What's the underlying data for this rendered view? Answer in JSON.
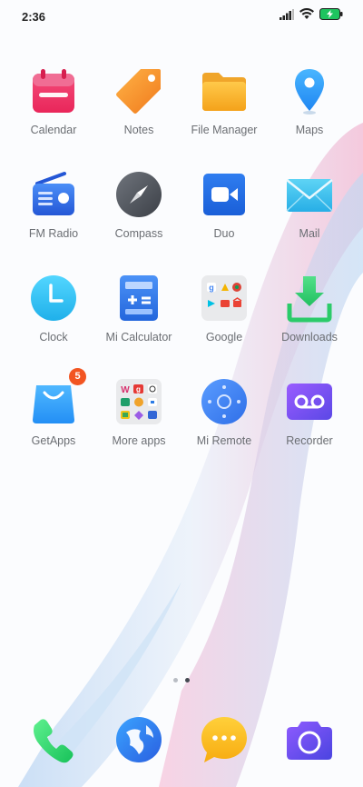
{
  "status_bar": {
    "time": "2:36",
    "icons": [
      "signal-icon",
      "wifi-icon",
      "battery-charging-icon"
    ]
  },
  "apps": [
    {
      "label": "Calendar",
      "icon": "calendar-icon"
    },
    {
      "label": "Notes",
      "icon": "notes-icon"
    },
    {
      "label": "File Manager",
      "icon": "folder-icon"
    },
    {
      "label": "Maps",
      "icon": "map-pin-icon"
    },
    {
      "label": "FM Radio",
      "icon": "radio-icon"
    },
    {
      "label": "Compass",
      "icon": "compass-icon"
    },
    {
      "label": "Duo",
      "icon": "video-camera-icon"
    },
    {
      "label": "Mail",
      "icon": "envelope-icon"
    },
    {
      "label": "Clock",
      "icon": "clock-icon"
    },
    {
      "label": "Mi Calculator",
      "icon": "calculator-icon"
    },
    {
      "label": "Google",
      "icon": "google-folder-icon"
    },
    {
      "label": "Downloads",
      "icon": "download-icon"
    },
    {
      "label": "GetApps",
      "icon": "shopping-bag-icon",
      "badge": "5"
    },
    {
      "label": "More apps",
      "icon": "apps-folder-icon"
    },
    {
      "label": "Mi Remote",
      "icon": "remote-icon"
    },
    {
      "label": "Recorder",
      "icon": "recorder-icon"
    }
  ],
  "pager": {
    "pages": 2,
    "current": 2
  },
  "dock": [
    {
      "icon": "phone-icon"
    },
    {
      "icon": "browser-icon"
    },
    {
      "icon": "messaging-icon"
    },
    {
      "icon": "camera-icon"
    }
  ],
  "colors": {
    "label_text": "#6b6e73",
    "badge": "#f25522",
    "wallpaper_pink": "#f6b8d2",
    "wallpaper_blue": "#bfd9f3"
  }
}
